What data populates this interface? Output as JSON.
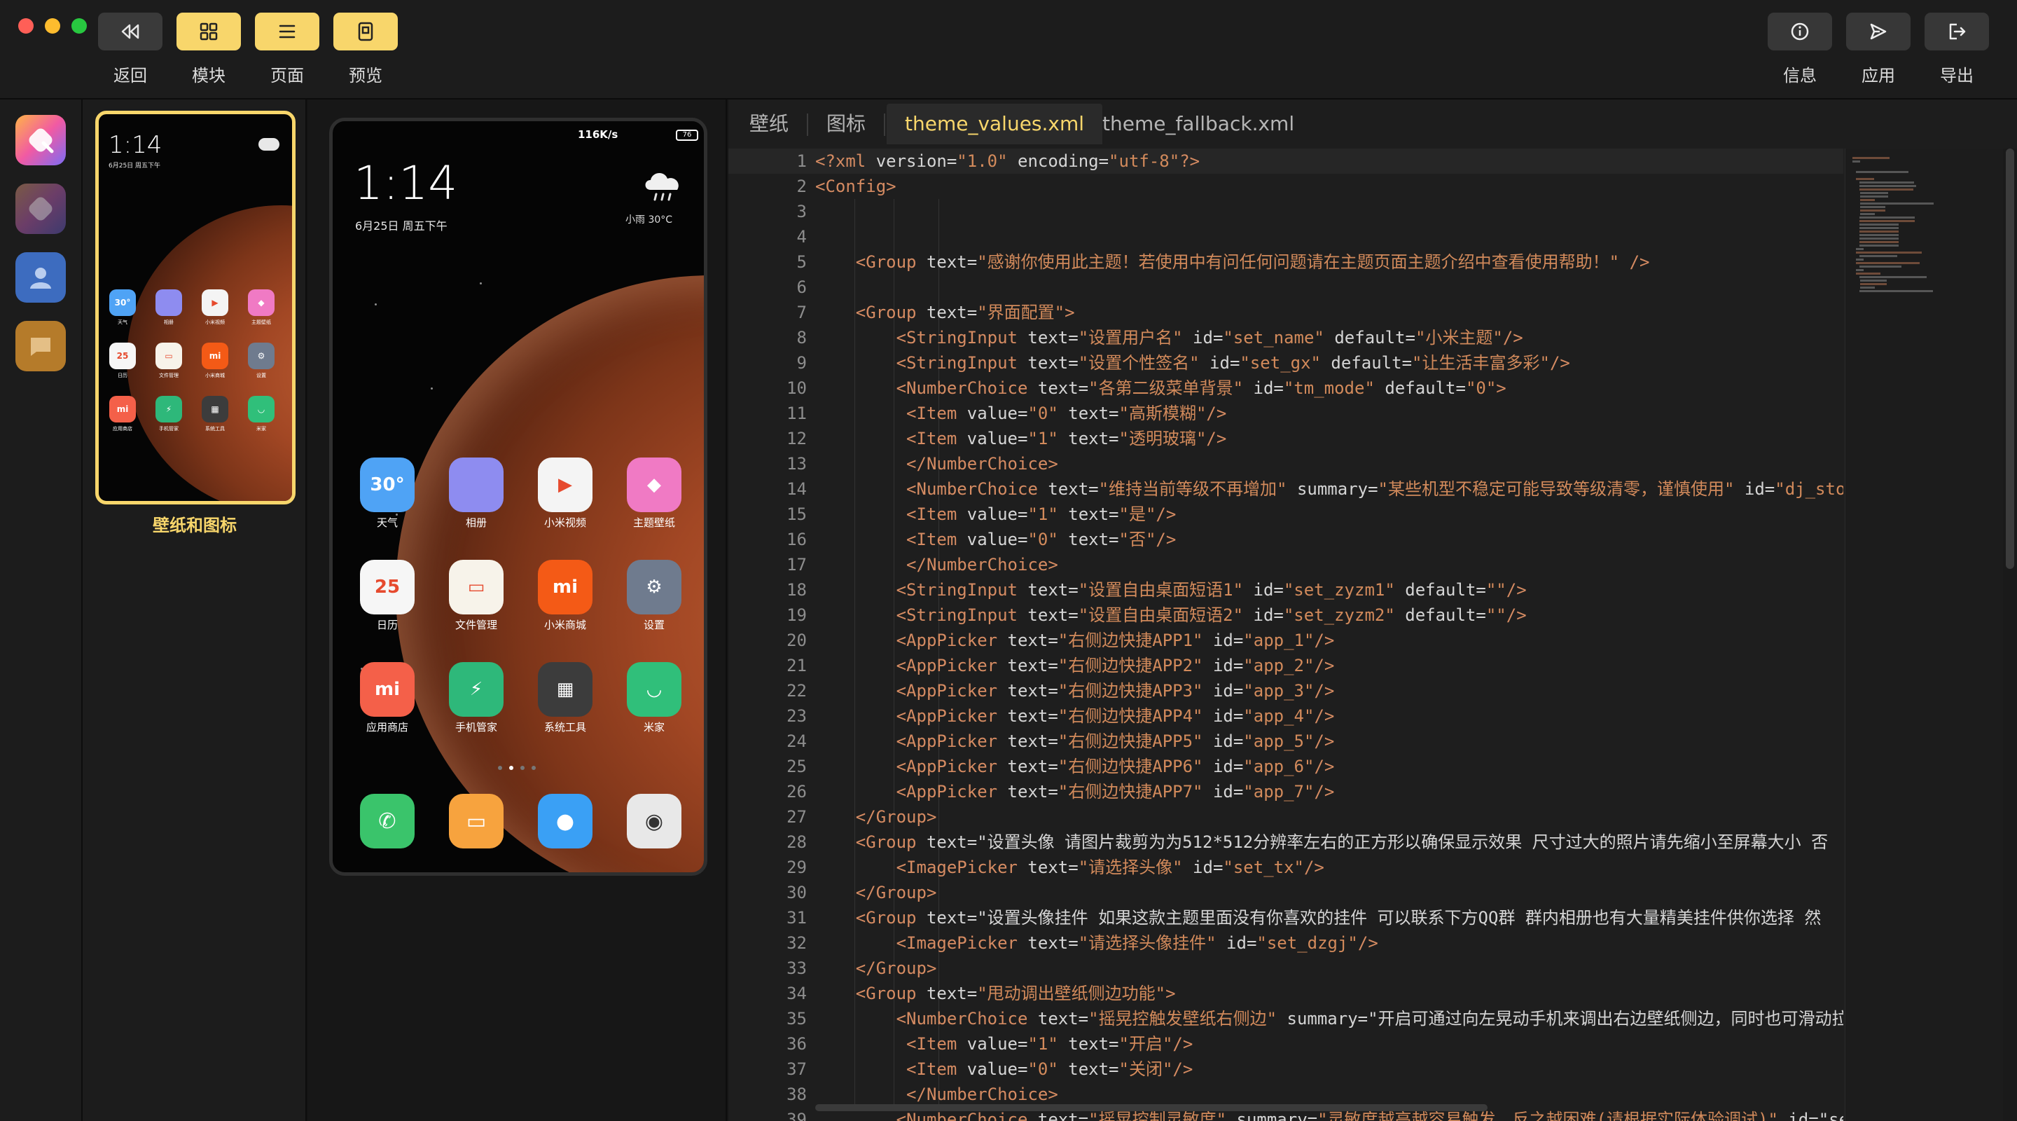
{
  "toolbar": {
    "left": [
      {
        "label": "返回",
        "icon": "rewind-icon"
      },
      {
        "label": "模块",
        "icon": "grid-icon"
      },
      {
        "label": "页面",
        "icon": "list-icon"
      },
      {
        "label": "预览",
        "icon": "preview-icon"
      }
    ],
    "right": [
      {
        "label": "信息",
        "icon": "info-icon"
      },
      {
        "label": "应用",
        "icon": "send-icon"
      },
      {
        "label": "导出",
        "icon": "export-icon"
      }
    ]
  },
  "rail": {
    "apps": [
      {
        "icon": "theme-app-icon",
        "color": "#f15aa3"
      },
      {
        "icon": "theme-app-dim-icon",
        "color": "#6b3d68"
      },
      {
        "icon": "user-icon",
        "color": "#3d6cbf"
      },
      {
        "icon": "chat-bubble-icon",
        "color": "#b57b2a"
      }
    ]
  },
  "thumb": {
    "label": "壁纸和图标"
  },
  "phone": {
    "network": "116K/s",
    "battery": "76",
    "time": "1:14",
    "date": "6月25日 周五下午",
    "weather": "小雨  30°C",
    "apps": [
      {
        "name": "天气",
        "glyph": "30°",
        "color": "#4fa3f5",
        "icon": "weather-app-icon"
      },
      {
        "name": "相册",
        "glyph": "",
        "color": "#8e8cf0",
        "icon": "gallery-app-icon"
      },
      {
        "name": "小米视频",
        "glyph": "▶",
        "color": "#f4f4f4",
        "icon": "video-app-icon"
      },
      {
        "name": "主题壁纸",
        "glyph": "◆",
        "color": "#f07ac4",
        "icon": "themes-app-icon"
      },
      {
        "name": "日历",
        "glyph": "25",
        "color": "#f6f6f6",
        "icon": "calendar-app-icon"
      },
      {
        "name": "文件管理",
        "glyph": "▭",
        "color": "#f7f3ea",
        "icon": "files-app-icon"
      },
      {
        "name": "小米商城",
        "glyph": "mi",
        "color": "#f45a16",
        "icon": "mall-app-icon"
      },
      {
        "name": "设置",
        "glyph": "⚙",
        "color": "#6f7b8e",
        "icon": "settings-app-icon"
      },
      {
        "name": "应用商店",
        "glyph": "mi",
        "color": "#f46049",
        "icon": "store-app-icon"
      },
      {
        "name": "手机管家",
        "glyph": "⚡",
        "color": "#2eb87a",
        "icon": "security-app-icon"
      },
      {
        "name": "系统工具",
        "glyph": "▦",
        "color": "#3c3c3c",
        "icon": "tools-app-icon"
      },
      {
        "name": "米家",
        "glyph": "◡",
        "color": "#30bf7a",
        "icon": "mijia-app-icon"
      }
    ],
    "dock": [
      {
        "glyph": "✆",
        "color": "#3ac46b",
        "icon": "phone-app-icon"
      },
      {
        "glyph": "▭",
        "color": "#f7a33e",
        "icon": "messages-app-icon"
      },
      {
        "glyph": "●",
        "color": "#3aa0f5",
        "icon": "browser-app-icon"
      },
      {
        "glyph": "◉",
        "color": "#e8e8e8",
        "icon": "camera-app-icon"
      }
    ]
  },
  "editor": {
    "tabs": [
      {
        "label": "壁纸",
        "active": false
      },
      {
        "label": "图标",
        "active": false
      },
      {
        "label": "theme_values.xml",
        "active": true
      },
      {
        "label": "theme_fallback.xml",
        "active": false
      }
    ],
    "lines": [
      "<?xml version=\"1.0\" encoding=\"utf-8\"?>",
      "<Config>",
      "",
      "",
      "    <Group text=\"感谢你使用此主题！若使用中有问任何问题请在主题页面主题介绍中查看使用帮助！\" />",
      "",
      "    <Group text=\"界面配置\">",
      "        <StringInput text=\"设置用户名\" id=\"set_name\" default=\"小米主题\"/>",
      "        <StringInput text=\"设置个性签名\" id=\"set_gx\" default=\"让生活丰富多彩\"/>",
      "        <NumberChoice text=\"各第二级菜单背景\" id=\"tm_mode\" default=\"0\">",
      "         <Item value=\"0\" text=\"高斯模糊\"/>",
      "         <Item value=\"1\" text=\"透明玻璃\"/>",
      "         </NumberChoice>",
      "         <NumberChoice text=\"维持当前等级不再增加\" summary=\"某些机型不稳定可能导致等级清零，谨慎使用\" id=\"dj_stop\"",
      "         <Item value=\"1\" text=\"是\"/>",
      "         <Item value=\"0\" text=\"否\"/>",
      "         </NumberChoice>",
      "        <StringInput text=\"设置自由桌面短语1\" id=\"set_zyzm1\" default=\"\"/>",
      "        <StringInput text=\"设置自由桌面短语2\" id=\"set_zyzm2\" default=\"\"/>",
      "        <AppPicker text=\"右侧边快捷APP1\" id=\"app_1\"/>",
      "        <AppPicker text=\"右侧边快捷APP2\" id=\"app_2\"/>",
      "        <AppPicker text=\"右侧边快捷APP3\" id=\"app_3\"/>",
      "        <AppPicker text=\"右侧边快捷APP4\" id=\"app_4\"/>",
      "        <AppPicker text=\"右侧边快捷APP5\" id=\"app_5\"/>",
      "        <AppPicker text=\"右侧边快捷APP6\" id=\"app_6\"/>",
      "        <AppPicker text=\"右侧边快捷APP7\" id=\"app_7\"/>",
      "    </Group>",
      "    <Group text=\"设置头像 请图片裁剪为为512*512分辨率左右的正方形以确保显示效果 尺寸过大的照片请先缩小至屏幕大小 否",
      "        <ImagePicker text=\"请选择头像\" id=\"set_tx\"/>",
      "    </Group>",
      "    <Group text=\"设置头像挂件 如果这款主题里面没有你喜欢的挂件 可以联系下方QQ群 群内相册也有大量精美挂件供你选择 然",
      "        <ImagePicker text=\"请选择头像挂件\" id=\"set_dzgj\"/>",
      "    </Group>",
      "    <Group text=\"甩动调出壁纸侧边功能\">",
      "        <NumberChoice text=\"摇晃控触发壁纸右侧边\" summary=\"开启可通过向左晃动手机来调出右边壁纸侧边，同时也可滑动拉",
      "         <Item value=\"1\" text=\"开启\"/>",
      "         <Item value=\"0\" text=\"关闭\"/>",
      "         </NumberChoice>",
      "        <NumberChoice text=\"摇晃控制灵敏度\" summary=\"灵敏度越高越容易触发，反之越困难(请根据实际体验调试)\" id=\"sens"
    ]
  }
}
